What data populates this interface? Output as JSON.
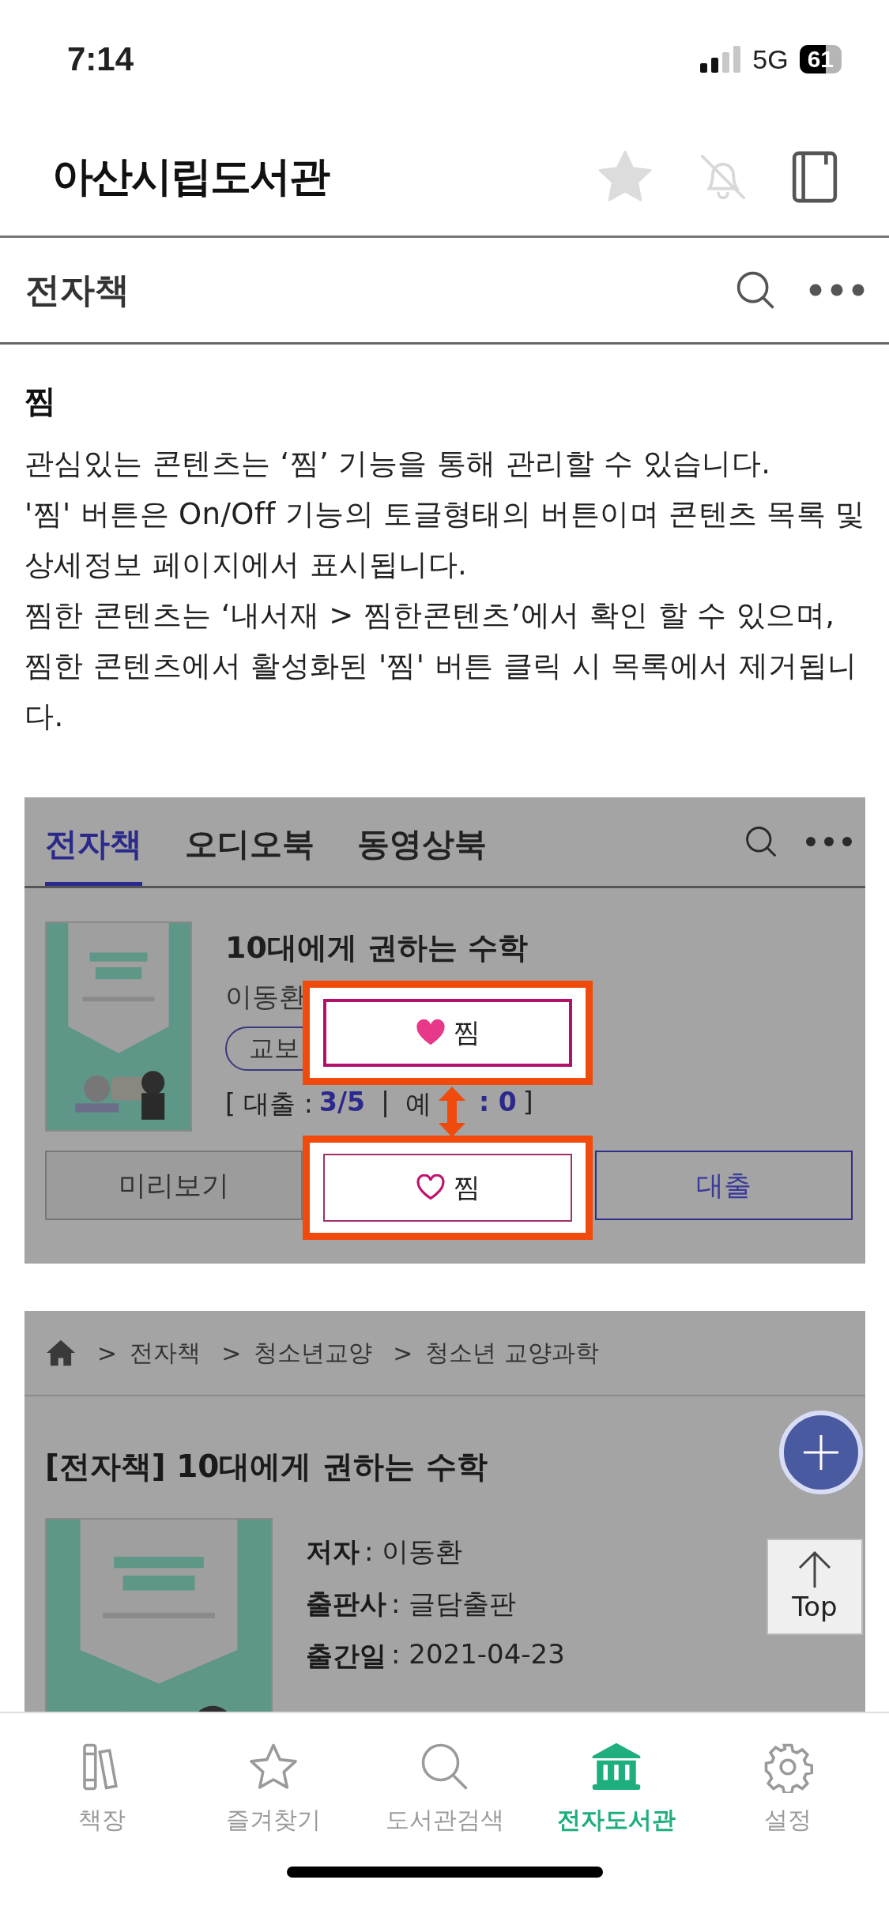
{
  "status_bar": {
    "time": "7:14",
    "network": "5G",
    "battery": "61"
  },
  "header": {
    "title": "아산시립도서관"
  },
  "subheader": {
    "title": "전자책"
  },
  "section": {
    "heading": "찜",
    "paragraphs": [
      "관심있는 콘텐츠는 ‘찜’ 기능을 통해 관리할 수 있습니다.",
      "'찜' 버튼은 On/Off 기능의 토글형태의 버튼이며 콘텐츠 목록 및 상세정보 페이지에서 표시됩니다.",
      "찜한 콘텐츠는 ‘내서재 > 찜한콘텐츠’에서 확인 할 수 있으며, 찜한 콘텐츠에서 활성화된 '찜' 버튼 클릭 시 목록에서 제거됩니다."
    ]
  },
  "list_screenshot": {
    "tabs": [
      {
        "label": "전자책",
        "selected": true
      },
      {
        "label": "오디오북",
        "selected": false
      },
      {
        "label": "동영상북",
        "selected": false
      }
    ],
    "book": {
      "title": "10대에게 권하는 수학",
      "author": "이동환",
      "badge": "교보",
      "loan_label": "[ 대출 :",
      "loan_value": "3/5",
      "divider": "|",
      "reserve_label": "예",
      "reserve_value": ": 0",
      "close": "]"
    },
    "buttons": [
      {
        "kind": "preview",
        "label": "미리보기"
      },
      {
        "kind": "loan",
        "label": "대출"
      }
    ],
    "callouts": [
      {
        "label": "찜",
        "on": true
      },
      {
        "label": "찜",
        "on": false
      }
    ]
  },
  "detail_screenshot": {
    "breadcrumb": [
      {
        "separator": ">",
        "label": "전자책"
      },
      {
        "separator": ">",
        "label": "청소년교양"
      },
      {
        "separator": ">",
        "label": "청소년 교양과학"
      }
    ],
    "title": "[전자책] 10대에게 권하는 수학",
    "details": [
      {
        "label": "저자",
        "value": ": 이동환"
      },
      {
        "label": "출판사",
        "value": ": 글담출판"
      },
      {
        "label": "출간일",
        "value": ": 2021-04-23"
      }
    ],
    "top_button": "Top"
  },
  "tab_bar": [
    {
      "label": "책장",
      "selected": false
    },
    {
      "label": "즐겨찾기",
      "selected": false
    },
    {
      "label": "도서관검색",
      "selected": false
    },
    {
      "label": "전자도서관",
      "selected": true
    },
    {
      "label": "설정",
      "selected": false
    }
  ]
}
